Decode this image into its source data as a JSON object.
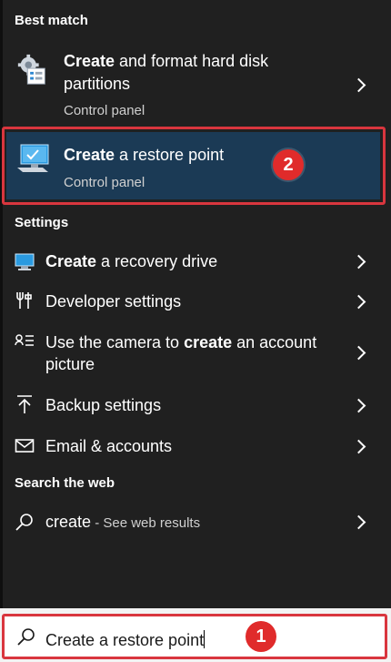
{
  "sections": {
    "best_match": "Best match",
    "settings": "Settings",
    "search_web": "Search the web"
  },
  "best_match": [
    {
      "title_bold": "Create",
      "title_rest": " and format hard disk",
      "title_line2": "partitions",
      "subtitle": "Control panel",
      "icon": "gear-doc-icon"
    },
    {
      "title_bold": "Create",
      "title_rest": " a restore point",
      "subtitle": "Control panel",
      "icon": "monitor-restore-icon",
      "selected": true
    }
  ],
  "settings": [
    {
      "bold": "Create",
      "rest": " a recovery drive",
      "icon": "monitor-icon"
    },
    {
      "text": "Developer settings",
      "icon": "tools-icon"
    },
    {
      "pre": "Use the camera to ",
      "bold": "create",
      "post": " an account",
      "line2": "picture",
      "icon": "account-icon"
    },
    {
      "text": "Backup settings",
      "icon": "upload-icon"
    },
    {
      "text": "Email & accounts",
      "icon": "mail-icon"
    }
  ],
  "web": {
    "query": "create",
    "suffix": " - See web results",
    "icon": "search-icon"
  },
  "search": {
    "value": "Create a restore point",
    "icon": "search-icon"
  },
  "badges": {
    "selected": "2",
    "search": "1"
  },
  "colors": {
    "highlight": "#1b3a55",
    "annotation": "#d9363e",
    "background": "#202020"
  }
}
